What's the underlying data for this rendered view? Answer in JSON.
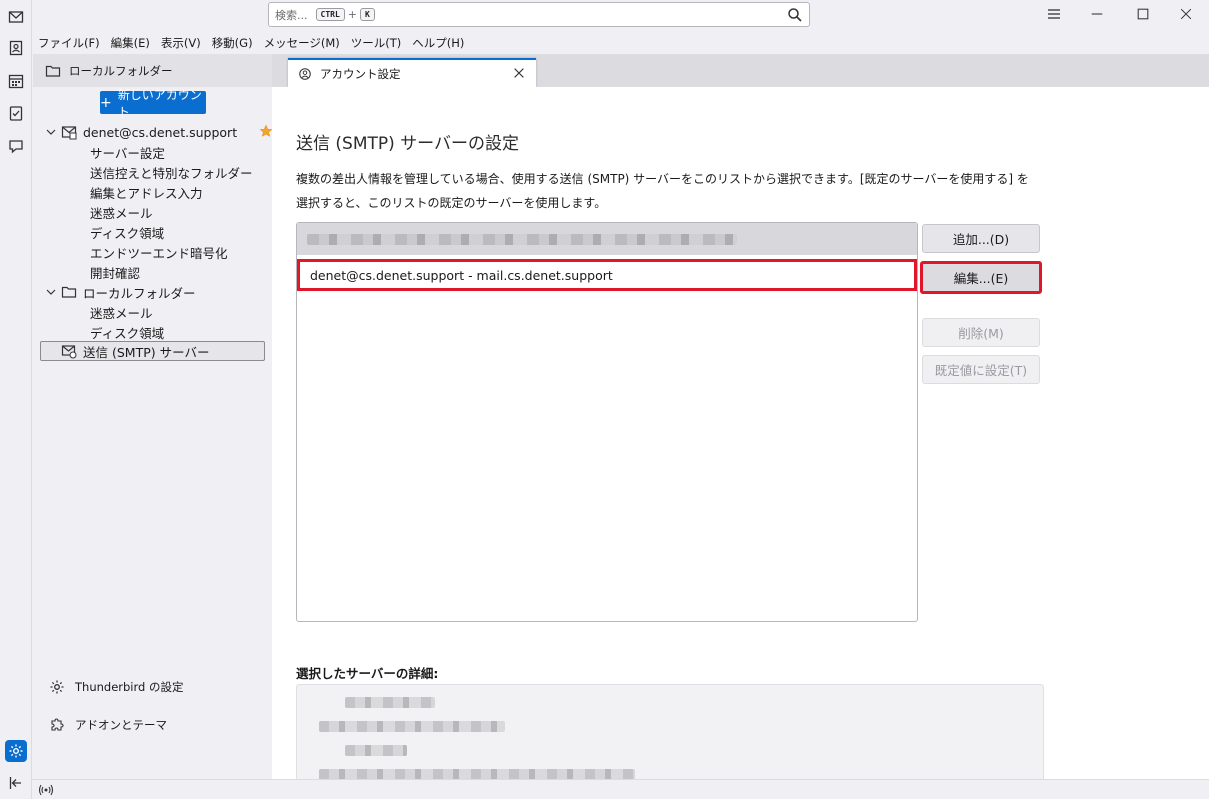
{
  "titlebar": {
    "search_placeholder": "検索...",
    "shortcut_ctrl": "CTRL",
    "shortcut_plus": "+",
    "shortcut_key": "K"
  },
  "menubar": {
    "items": [
      "ファイル(F)",
      "編集(E)",
      "表示(V)",
      "移動(G)",
      "メッセージ(M)",
      "ツール(T)",
      "ヘルプ(H)"
    ]
  },
  "folder_pane": {
    "header": "ローカルフォルダー"
  },
  "tab": {
    "label": "アカウント設定"
  },
  "sidebar": {
    "new_account": "新しいアカウント",
    "account": {
      "name": "denet@cs.denet.support",
      "items": [
        "サーバー設定",
        "送信控えと特別なフォルダー",
        "編集とアドレス入力",
        "迷惑メール",
        "ディスク領域",
        "エンドツーエンド暗号化",
        "開封確認"
      ]
    },
    "local": {
      "name": "ローカルフォルダー",
      "items": [
        "迷惑メール",
        "ディスク領域"
      ]
    },
    "smtp": "送信 (SMTP) サーバー",
    "settings_link": "Thunderbird の設定",
    "addons_link": "アドオンとテーマ"
  },
  "main": {
    "title": "送信 (SMTP) サーバーの設定",
    "description": "複数の差出人情報を管理している場合、使用する送信 (SMTP) サーバーをこのリストから選択できます。[既定のサーバーを使用する] を選択すると、このリストの既定のサーバーを使用します。",
    "servers": [
      "denet@cs.denet.support - mail.cs.denet.support"
    ],
    "buttons": {
      "add": "追加...(D)",
      "edit": "編集...(E)",
      "remove": "削除(M)",
      "set_default": "既定値に設定(T)"
    },
    "details_label": "選択したサーバーの詳細:"
  },
  "colors": {
    "accent": "#0a6ed1",
    "highlight": "#e0162b"
  }
}
